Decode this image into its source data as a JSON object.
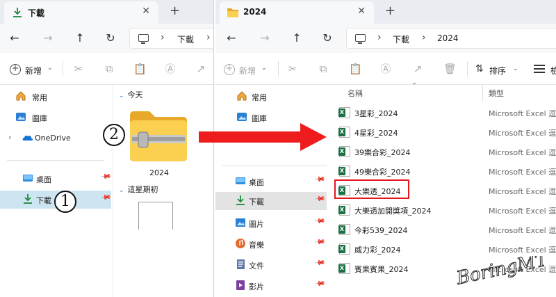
{
  "left_window": {
    "tab_title": "下載",
    "address_segments": [
      "下載"
    ],
    "new_label": "新增",
    "sidebar": {
      "quick": [
        {
          "label": "常用",
          "icon": "home-icon"
        },
        {
          "label": "圖庫",
          "icon": "gallery-icon"
        }
      ],
      "onedrive": "OneDrive",
      "pinned": [
        {
          "label": "桌面",
          "icon": "desktop-icon"
        },
        {
          "label": "下載",
          "icon": "download-icon",
          "selected": true
        }
      ]
    },
    "content": {
      "group_today": "今天",
      "folder_name": "2024",
      "group_earlier": "這星期初"
    }
  },
  "right_window": {
    "tab_title": "2024",
    "address_segments": [
      "下載",
      "2024"
    ],
    "new_label": "新增",
    "sort_label": "排序",
    "view_label": "檢",
    "sidebar": {
      "quick": [
        {
          "label": "常用",
          "icon": "home-icon"
        },
        {
          "label": "圖庫",
          "icon": "gallery-icon"
        }
      ],
      "onedrive": "OneDrive",
      "pinned": [
        {
          "label": "桌面",
          "icon": "desktop-icon"
        },
        {
          "label": "下載",
          "icon": "download-icon",
          "selected": true
        },
        {
          "label": "圖片",
          "icon": "pictures-icon"
        },
        {
          "label": "音樂",
          "icon": "music-icon"
        },
        {
          "label": "文件",
          "icon": "documents-icon"
        },
        {
          "label": "影片",
          "icon": "videos-icon"
        }
      ]
    },
    "columns": {
      "name": "名稱",
      "type": "類型"
    },
    "files": [
      {
        "name": "3星彩_2024",
        "type": "Microsoft Excel 逗號"
      },
      {
        "name": "4星彩_2024",
        "type": "Microsoft Excel 逗號"
      },
      {
        "name": "39樂合彩_2024",
        "type": "Microsoft Excel 逗號"
      },
      {
        "name": "49樂合彩_2024",
        "type": "Microsoft Excel 逗號"
      },
      {
        "name": "大樂透_2024",
        "type": "Microsoft Excel 逗號",
        "highlighted": true
      },
      {
        "name": "大樂透加開獎項_2024",
        "type": "Microsoft Excel 逗號"
      },
      {
        "name": "今彩539_2024",
        "type": "Microsoft Excel 逗號"
      },
      {
        "name": "威力彩_2024",
        "type": "Microsoft Excel 逗號"
      },
      {
        "name": "賓果賓果_2024",
        "type": "Microsoft Excel 逗號"
      }
    ]
  },
  "annotations": {
    "step1": "1",
    "step2": "2",
    "highlight_color": "#e8141c",
    "arrow_color": "#ee1c1c"
  },
  "watermark_text": "BoringMT"
}
